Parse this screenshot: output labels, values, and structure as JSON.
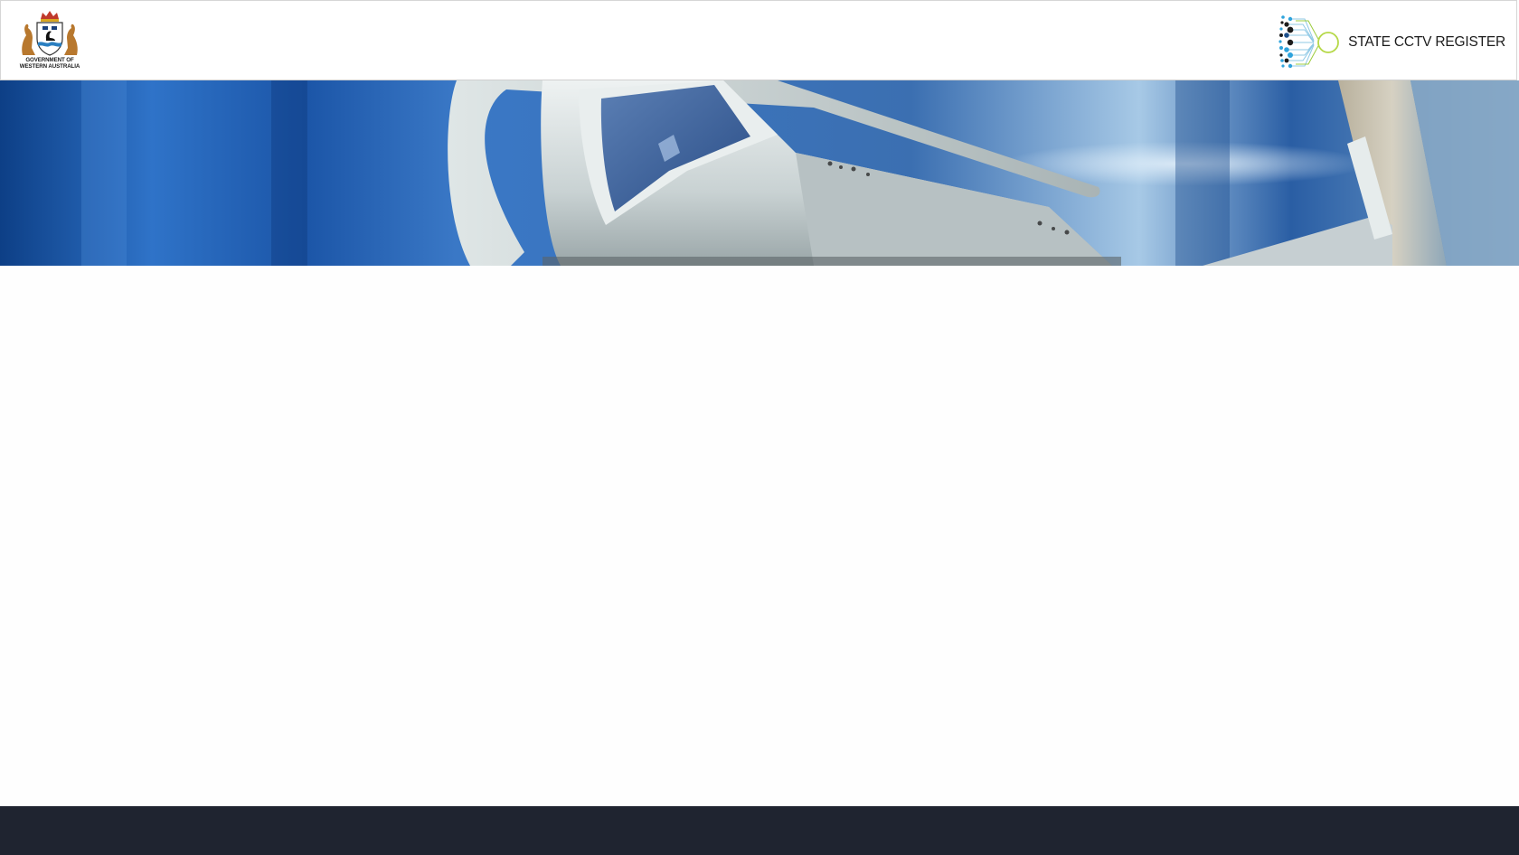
{
  "header": {
    "gov_logo": {
      "line1": "GOVERNMENT OF",
      "line2": "WESTERN AUSTRALIA",
      "icon": "wa-coat-of-arms-icon"
    },
    "site_logo": {
      "title": "STATE CCTV REGISTER",
      "icon": "state-cctv-register-logo-icon"
    }
  },
  "hero": {
    "image": "cctv-camera-banner"
  },
  "colors": {
    "footer_bg": "#1f2430",
    "logo_blue": "#2ea3dc",
    "logo_green": "#9ccc3c",
    "logo_dark": "#1c1c1c"
  }
}
